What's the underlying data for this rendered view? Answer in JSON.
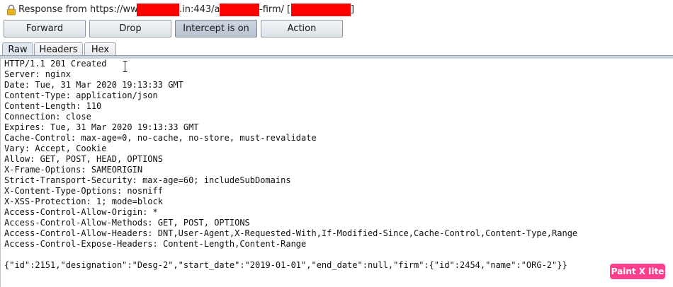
{
  "titlebar": {
    "prefix": "Response from https://www.",
    "part2": ".in:443/api/",
    "part3": "-firm/",
    "bracket_open": "[",
    "bracket_close": "]",
    "redaction_color": "#ff0000"
  },
  "toolbar": {
    "forward_label": "Forward",
    "drop_label": "Drop",
    "intercept_label": "Intercept is on",
    "action_label": "Action"
  },
  "tabs": [
    {
      "label": "Raw"
    },
    {
      "label": "Headers"
    },
    {
      "label": "Hex"
    }
  ],
  "response": {
    "lines": [
      "HTTP/1.1 201 Created",
      "Server: nginx",
      "Date: Tue, 31 Mar 2020 19:13:33 GMT",
      "Content-Type: application/json",
      "Content-Length: 110",
      "Connection: close",
      "Expires: Tue, 31 Mar 2020 19:13:33 GMT",
      "Cache-Control: max-age=0, no-cache, no-store, must-revalidate",
      "Vary: Accept, Cookie",
      "Allow: GET, POST, HEAD, OPTIONS",
      "X-Frame-Options: SAMEORIGIN",
      "Strict-Transport-Security: max-age=60; includeSubDomains",
      "X-Content-Type-Options: nosniff",
      "X-XSS-Protection: 1; mode=block",
      "Access-Control-Allow-Origin: *",
      "Access-Control-Allow-Methods: GET, POST, OPTIONS",
      "Access-Control-Allow-Headers: DNT,User-Agent,X-Requested-With,If-Modified-Since,Cache-Control,Content-Type,Range",
      "Access-Control-Expose-Headers: Content-Length,Content-Range",
      "",
      "{\"id\":2151,\"designation\":\"Desg-2\",\"start_date\":\"2019-01-01\",\"end_date\":null,\"firm\":{\"id\":2454,\"name\":\"ORG-2\"}}"
    ]
  },
  "watermark": {
    "label": "Paint X lite",
    "color": "#ff3f8e"
  }
}
